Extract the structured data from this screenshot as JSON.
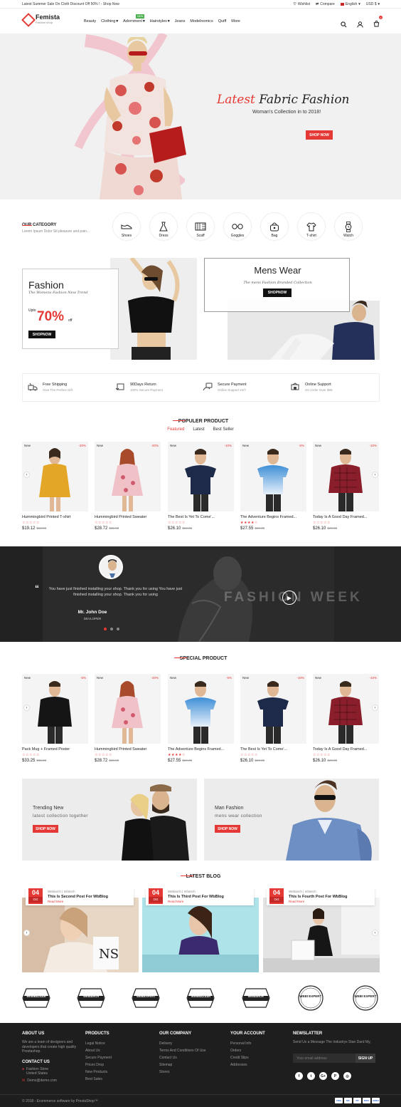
{
  "topbar": {
    "promo": "Latest Summer Sale On Cloth Discount Off 50% ! - Shop Now",
    "wishlist": "Wishlist",
    "compare": "Compare",
    "language": "English",
    "currency": "USD $"
  },
  "header": {
    "logo_name": "Femista",
    "logo_sub": "Fashion shop",
    "nav": [
      "Beauty",
      "Clothing",
      "Adornment",
      "Hairstyles",
      "Jeans",
      "Modelnomics",
      "Quiff",
      "More"
    ],
    "new_tag": "NEW",
    "cart_count": "0"
  },
  "hero": {
    "title_red": "Latest",
    "title_black": "Fabric Fashion",
    "subtitle": "Woman's Collection in to 2018!",
    "button": "SHOP NOW"
  },
  "category": {
    "title": "OUR CATEGORY",
    "subtitle": "Lorem Ipsum Dolor Sit pleasure and pain...",
    "items": [
      {
        "label": "Shoes",
        "icon": "shoe-icon"
      },
      {
        "label": "Dress",
        "icon": "dress-icon"
      },
      {
        "label": "Scaff",
        "icon": "scarf-icon"
      },
      {
        "label": "Goggles",
        "icon": "goggles-icon"
      },
      {
        "label": "Bag",
        "icon": "bag-icon"
      },
      {
        "label": "T-shirt",
        "icon": "tshirt-icon"
      },
      {
        "label": "Watch",
        "icon": "watch-icon"
      }
    ]
  },
  "promo_fashion": {
    "title": "Fashion",
    "subtitle": "The Womens Fashion New Trend",
    "upto": "Upto",
    "percent": "70%",
    "off": "off",
    "button": "SHOPNOW"
  },
  "promo_mens": {
    "title": "Mens Wear",
    "subtitle": "The mens Fashion Branded Collection",
    "button": "SHOPNOW"
  },
  "services": [
    {
      "title": "Free Shipping",
      "sub": "Give The Perfect Gift",
      "icon": "shipping-icon"
    },
    {
      "title": "90Days Return",
      "sub": "100% Secure Payment",
      "icon": "return-icon"
    },
    {
      "title": "Secure Payment",
      "sub": "Online Support 24/7",
      "icon": "payment-icon"
    },
    {
      "title": "Online Support",
      "sub": "On Order Over $99",
      "icon": "support-icon"
    }
  ],
  "popular": {
    "title": "POPULER PRODUCT",
    "tabs": [
      "Featured",
      "Latest",
      "Best Seller"
    ],
    "products": [
      {
        "badge": "New",
        "discount": "-20%",
        "name": "Hummingbird Printed T-shirt",
        "price": "$19.12",
        "old": "$23.90",
        "rating": 0,
        "img": "yellow-dress"
      },
      {
        "badge": "New",
        "discount": "-20%",
        "name": "Hummingbird Printed Sweater",
        "price": "$28.72",
        "old": "$35.90",
        "rating": 0,
        "img": "floral-dress"
      },
      {
        "badge": "New",
        "discount": "-10%",
        "name": "The Best Is Yet To Come'...",
        "price": "$26.10",
        "old": "$29.00",
        "rating": 0,
        "img": "navy-tee"
      },
      {
        "badge": "New",
        "discount": "-5%",
        "name": "The Adventure Begins Framed...",
        "price": "$27.55",
        "old": "$29.00",
        "rating": 4,
        "img": "blue-polo"
      },
      {
        "badge": "New",
        "discount": "-10%",
        "name": "Today Is A Good Day Framed...",
        "price": "$26.10",
        "old": "$29.00",
        "rating": 0,
        "img": "red-shirt"
      }
    ]
  },
  "testimonial": {
    "text": "You have just finished installing your shop. Thank you for using You have just finished installing your shop. Thank you for using",
    "name": "Mr. John Doe",
    "role": "DEVLOPER",
    "bg_text": "FASHION WEEK"
  },
  "special": {
    "title": "SPECIAL PRODUCT",
    "products": [
      {
        "badge": "New",
        "discount": "-5%",
        "name": "Pack Mug + Framed Poster",
        "price": "$33.25",
        "old": "$35.00",
        "rating": 0,
        "img": "black-shirt"
      },
      {
        "badge": "New",
        "discount": "-20%",
        "name": "Hummingbird Printed Sweater",
        "price": "$28.72",
        "old": "$35.90",
        "rating": 0,
        "img": "floral-dress"
      },
      {
        "badge": "New",
        "discount": "-5%",
        "name": "The Adventure Begins Framed...",
        "price": "$27.55",
        "old": "$29.00",
        "rating": 4,
        "img": "blue-polo"
      },
      {
        "badge": "New",
        "discount": "-10%",
        "name": "The Best Is Yet To Come'...",
        "price": "$26.10",
        "old": "$29.00",
        "rating": 0,
        "img": "navy-tee"
      },
      {
        "badge": "New",
        "discount": "-10%",
        "name": "Today Is A Good Day Framed...",
        "price": "$26.10",
        "old": "$29.00",
        "rating": 0,
        "img": "red-shirt"
      }
    ]
  },
  "banners": [
    {
      "title": "Trending New",
      "sub": "latest collection together",
      "button": "SHOP NOW"
    },
    {
      "title": "Man Fashion",
      "sub": "mens wear collection",
      "button": "SHOP NOW"
    }
  ],
  "blog": {
    "title": "LATEST BLOG",
    "posts": [
      {
        "day": "04",
        "month": "Oct",
        "meta": "Webiarch | Infotech",
        "title": "This Is Second Post For WbBlog",
        "more": "Read More"
      },
      {
        "day": "04",
        "month": "Oct",
        "meta": "Webiarch | Infotech",
        "title": "This Is Third Post For WbBlog",
        "more": "Read More"
      },
      {
        "day": "04",
        "month": "Oct",
        "meta": "Webiarch | Infotech",
        "title": "This Is Fourth Post For WbBlog",
        "more": "Read More"
      }
    ]
  },
  "brands": [
    "WEBIBAZAAR",
    "WEBIARCH",
    "WEBIEXPERT",
    "WEBIBAZAAR",
    "WEBIARCH",
    "WEBI EXPERT",
    "WEBI EXPERT"
  ],
  "footer": {
    "about_title": "ABOUT US",
    "about_text": "We are a team of designers and developers that create high quality Prestashop.",
    "contact_title": "CONTACT US",
    "address1": "Fashion Store",
    "address2": "United States",
    "email": "Demo@demo.com",
    "products_title": "PRODUCTS",
    "products": [
      "Legal Notice",
      "About Us",
      "Secure Payment",
      "Prices Drop",
      "New Products",
      "Best Sales"
    ],
    "company_title": "OUR COMPANY",
    "company": [
      "Delivery",
      "Terms And Conditions Of Use",
      "Contact Us",
      "Sitemap",
      "Stores"
    ],
    "account_title": "YOUR ACCOUNT",
    "account": [
      "Personal Info",
      "Orders",
      "Credit Slips",
      "Addresses"
    ],
    "news_title": "NEWSLATTER",
    "news_text": "Send Us a Message The Industrys Stan Dard My,",
    "news_placeholder": "Your email address",
    "news_button": "SIGN UP",
    "socials": [
      "f",
      "t",
      "G+",
      "P",
      "◎"
    ],
    "copyright": "© 2018 - Ecommerce software by PrestaShop™",
    "payments": [
      "VISA",
      "MC",
      "PP",
      "DISC",
      "AMEX"
    ]
  }
}
